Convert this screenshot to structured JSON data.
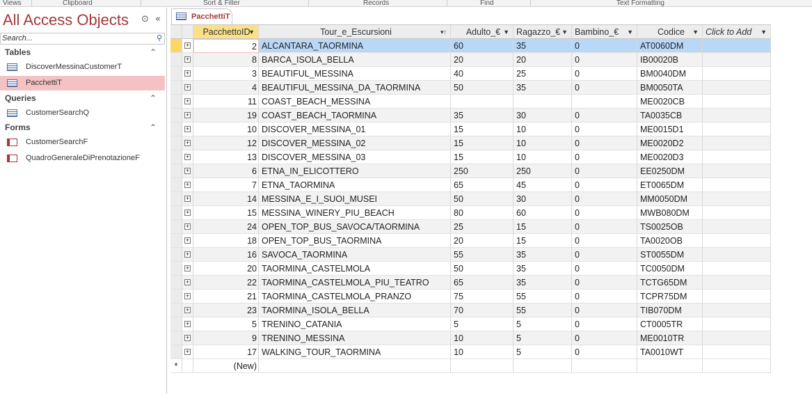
{
  "ribbon": {
    "groups": [
      "Views",
      "Clipboard",
      "Sort & Filter",
      "Records",
      "Find",
      "Text Formatting"
    ]
  },
  "nav": {
    "title": "All Access Objects",
    "search_placeholder": "Search...",
    "groups": [
      {
        "label": "Tables",
        "items": [
          "DiscoverMessinaCustomerT",
          "PacchettiT"
        ]
      },
      {
        "label": "Queries",
        "items": [
          "CustomerSearchQ"
        ]
      },
      {
        "label": "Forms",
        "items": [
          "CustomerSearchF",
          "QuadroGeneraleDiPrenotazioneF"
        ]
      }
    ],
    "selected": "PacchettiT"
  },
  "tab": {
    "label": "PacchettiT"
  },
  "table": {
    "columns": [
      "PacchettoID",
      "Tour_e_Escursioni",
      "Adulto_€",
      "Ragazzo_€",
      "Bambino_€",
      "Codice",
      "Click to Add"
    ],
    "rows": [
      [
        "2",
        "ALCANTARA_TAORMINA",
        "60",
        "35",
        "0",
        "AT0060DM"
      ],
      [
        "8",
        "BARCA_ISOLA_BELLA",
        "20",
        "20",
        "0",
        "IB00020B"
      ],
      [
        "3",
        "BEAUTIFUL_MESSINA",
        "40",
        "25",
        "0",
        "BM0040DM"
      ],
      [
        "4",
        "BEAUTIFUL_MESSINA_DA_TAORMINA",
        "50",
        "35",
        "0",
        "BM0050TA"
      ],
      [
        "11",
        "COAST_BEACH_MESSINA",
        "",
        "",
        "",
        "ME0020CB"
      ],
      [
        "19",
        "COAST_BEACH_TAORMINA",
        "35",
        "30",
        "0",
        "TA0035CB"
      ],
      [
        "10",
        "DISCOVER_MESSINA_01",
        "15",
        "10",
        "0",
        "ME0015D1"
      ],
      [
        "12",
        "DISCOVER_MESSINA_02",
        "15",
        "10",
        "0",
        "ME0020D2"
      ],
      [
        "13",
        "DISCOVER_MESSINA_03",
        "15",
        "10",
        "0",
        "ME0020D3"
      ],
      [
        "6",
        "ETNA_IN_ELICOTTERO",
        "250",
        "250",
        "0",
        "EE0250DM"
      ],
      [
        "7",
        "ETNA_TAORMINA",
        "65",
        "45",
        "0",
        "ET0065DM"
      ],
      [
        "14",
        "MESSINA_E_I_SUOI_MUSEI",
        "50",
        "30",
        "0",
        "MM0050DM"
      ],
      [
        "15",
        "MESSINA_WINERY_PIU_BEACH",
        "80",
        "60",
        "0",
        "MWB080DM"
      ],
      [
        "24",
        "OPEN_TOP_BUS_SAVOCA/TAORMINA",
        "25",
        "15",
        "0",
        "TS0025OB"
      ],
      [
        "18",
        "OPEN_TOP_BUS_TAORMINA",
        "20",
        "15",
        "0",
        "TA0020OB"
      ],
      [
        "16",
        "SAVOCA_TAORMINA",
        "55",
        "35",
        "0",
        "ST0055DM"
      ],
      [
        "20",
        "TAORMINA_CASTELMOLA",
        "50",
        "35",
        "0",
        "TC0050DM"
      ],
      [
        "22",
        "TAORMINA_CASTELMOLA_PIU_TEATRO",
        "65",
        "35",
        "0",
        "TCTG65DM"
      ],
      [
        "21",
        "TAORMINA_CASTELMOLA_PRANZO",
        "75",
        "55",
        "0",
        "TCPR75DM"
      ],
      [
        "23",
        "TAORMINA_ISOLA_BELLA",
        "70",
        "55",
        "0",
        "TIB070DM"
      ],
      [
        "5",
        "TRENINO_CATANIA",
        "5",
        "5",
        "0",
        "CT0005TR"
      ],
      [
        "9",
        "TRENINO_MESSINA",
        "10",
        "5",
        "0",
        "ME0010TR"
      ],
      [
        "17",
        "WALKING_TOUR_TAORMINA",
        "10",
        "5",
        "0",
        "TA0010WT"
      ]
    ],
    "new_row_label": "(New)",
    "new_row_marker": "*"
  }
}
